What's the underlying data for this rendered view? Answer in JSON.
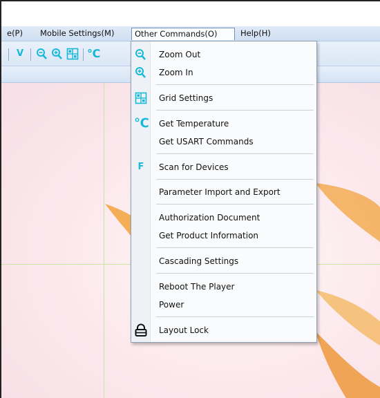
{
  "menubar": {
    "items": [
      {
        "label": "e(P)"
      },
      {
        "label": "Mobile Settings(M)"
      },
      {
        "label": "Other Commands(O)"
      },
      {
        "label": "Help(H)"
      }
    ]
  },
  "toolbar": {
    "v_label": "V",
    "temp_label": "℃"
  },
  "dropdown": {
    "items": [
      {
        "label": "Zoom Out",
        "icon": "zoom-out-icon"
      },
      {
        "label": "Zoom In",
        "icon": "zoom-in-icon"
      },
      {
        "label": "Grid Settings",
        "icon": "grid-icon"
      },
      {
        "label": "Get Temperature",
        "icon": "celsius-icon",
        "icon_glyph": "℃"
      },
      {
        "label": "Get USART Commands"
      },
      {
        "label": "Scan for Devices",
        "icon": "f-icon",
        "icon_glyph": "F"
      },
      {
        "label": "Parameter Import and Export"
      },
      {
        "label": "Authorization Document"
      },
      {
        "label": "Get Product Information"
      },
      {
        "label": "Cascading Settings"
      },
      {
        "label": "Reboot The Player"
      },
      {
        "label": "Power"
      },
      {
        "label": "Layout Lock",
        "icon": "lock-icon"
      }
    ]
  },
  "colors": {
    "accent": "#16b9d8",
    "menubar": "#cfdff2",
    "canvas": "#fbe7ec"
  }
}
